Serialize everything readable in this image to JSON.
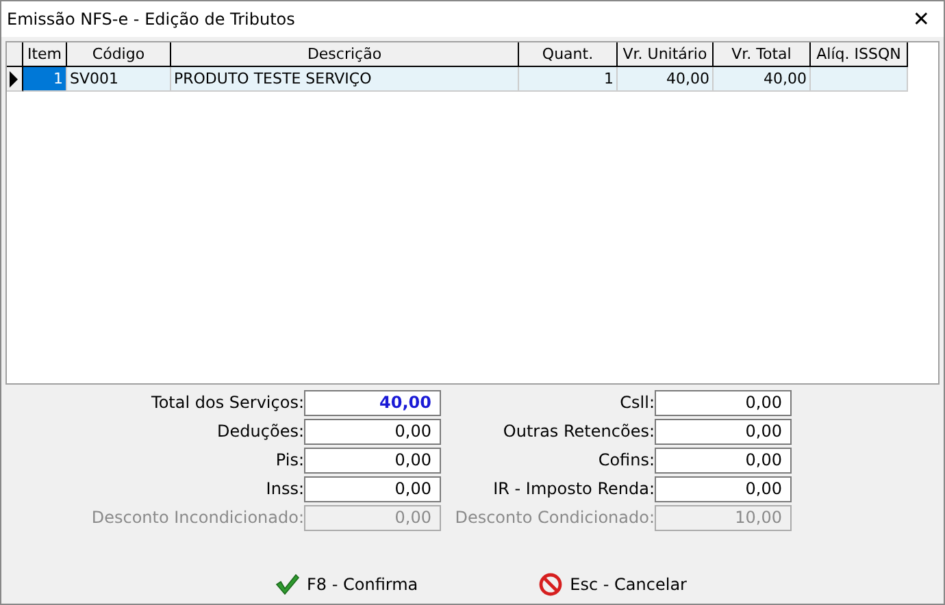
{
  "window": {
    "title": "Emissão NFS-e - Edição de Tributos",
    "close": "✕"
  },
  "table": {
    "columns": [
      "Item",
      "Código",
      "Descrição",
      "Quant.",
      "Vr. Unitário",
      "Vr. Total",
      "Alíq. ISSQN"
    ],
    "rows": [
      {
        "selected": true,
        "cells": [
          "1",
          "SV001",
          "PRODUTO TESTE SERVIÇO",
          "1",
          "40,00",
          "40,00",
          ""
        ]
      }
    ]
  },
  "fields": [
    {
      "label": "Total dos Serviços:",
      "value": "40,00",
      "disabled": false,
      "highlighted": true
    },
    {
      "label": "Csll:",
      "value": "0,00",
      "disabled": false,
      "highlighted": false
    },
    {
      "label": "Deduções:",
      "value": "0,00",
      "disabled": false,
      "highlighted": false
    },
    {
      "label": "Outras Retencões:",
      "value": "0,00",
      "disabled": false,
      "highlighted": false
    },
    {
      "label": "Pis:",
      "value": "0,00",
      "disabled": false,
      "highlighted": false
    },
    {
      "label": "Cofins:",
      "value": "0,00",
      "disabled": false,
      "highlighted": false
    },
    {
      "label": "Inss:",
      "value": "0,00",
      "disabled": false,
      "highlighted": false
    },
    {
      "label": "IR - Imposto Renda:",
      "value": "0,00",
      "disabled": false,
      "highlighted": false
    },
    {
      "label": "Desconto Incondicionado:",
      "value": "0,00",
      "disabled": true,
      "highlighted": false
    },
    {
      "label": "Desconto Condicionado:",
      "value": "10,00",
      "disabled": true,
      "highlighted": false
    }
  ],
  "buttons": [
    {
      "kind": "confirm",
      "label": "F8 - Confirma"
    },
    {
      "kind": "cancel",
      "label": "Esc - Cancelar"
    }
  ]
}
